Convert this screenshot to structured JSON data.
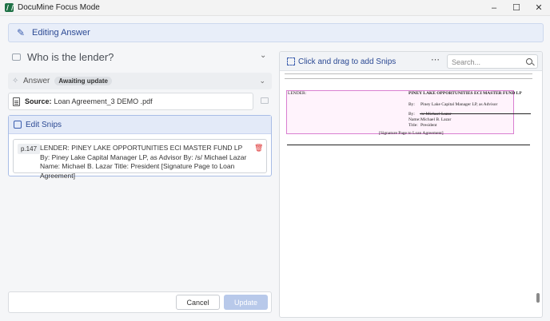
{
  "window": {
    "title": "DocuMine Focus Mode",
    "minimize": "–",
    "maximize": "☐",
    "close": "✕"
  },
  "banner": {
    "label": "Editing Answer",
    "icon": "pencil-icon"
  },
  "question": {
    "text": "Who is the lender?",
    "icon": "question-card-icon"
  },
  "answer": {
    "label": "Answer",
    "status": "Awaiting update"
  },
  "source": {
    "label": "Source:",
    "value": "Loan Agreement_3 DEMO .pdf"
  },
  "snips": {
    "header": "Edit Snips",
    "items": [
      {
        "page": "p.147",
        "text": "LENDER: PINEY LAKE OPPORTUNITIES ECI MASTER FUND LP By: Piney Lake Capital Manager LP, as Advisor By: /s/ Michael Lazar Name: Michael B. Lazar Title: President [Signature Page to Loan Agreement]"
      }
    ]
  },
  "actions": {
    "cancel": "Cancel",
    "update": "Update"
  },
  "viewer": {
    "header": "Click and drag to add Snips",
    "more": "⋯",
    "search_placeholder": "Search...",
    "doc": {
      "lender_label": "LENDER:",
      "fund_name": "PINEY LAKE OPPORTUNITIES ECI MASTER FUND LP",
      "by1_label": "By:",
      "by1_value": "Piney Lake Capital Manager LP, as Advisor",
      "by2_label": "By:",
      "by2_value": "/s/ Michael Lazar",
      "name_label": "Name:",
      "name_value": "Michael B. Lazar",
      "title_label": "Title:",
      "title_value": "President",
      "footer": "[Signature Page to Loan Agreement]"
    }
  },
  "colors": {
    "accent": "#2c4a94",
    "banner_bg": "#e8eef9",
    "snip_highlight": "#fff3fc",
    "snip_border": "#d97fd0",
    "delete": "#dd3333",
    "update_disabled": "#b8c9ea"
  }
}
